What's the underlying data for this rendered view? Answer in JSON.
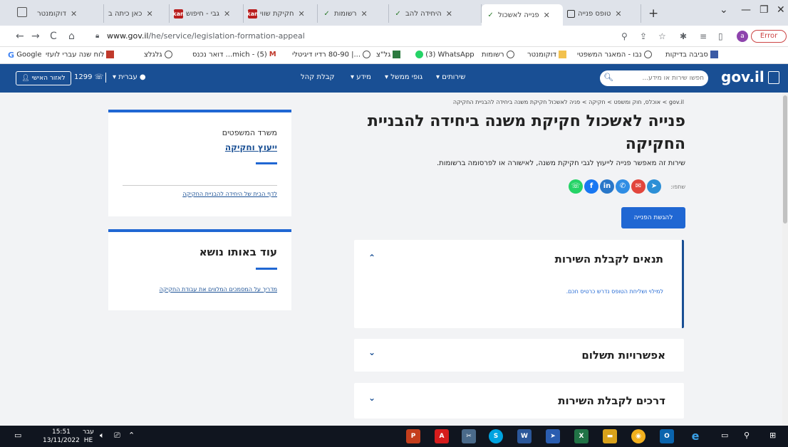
{
  "browser": {
    "tabs": [
      {
        "title": "דוקומנטר",
        "icon": "doc-icon"
      },
      {
        "title": "כאן כיתה ב",
        "icon": "bar-icon"
      },
      {
        "title": "גבי - חיפוש",
        "icon": "kan-icon"
      },
      {
        "title": "חקיקת שווי",
        "icon": "kan-icon"
      },
      {
        "title": "רשומות",
        "icon": "check-icon"
      },
      {
        "title": "היחידה להב",
        "icon": "check-icon"
      },
      {
        "title": "פנייה לאשכול",
        "icon": "check-icon",
        "active": true
      },
      {
        "title": "טופס פנייה",
        "icon": "doc-icon"
      }
    ],
    "url_host": "www.gov.il",
    "url_path": "/he/service/legislation-formation-appeal",
    "error_label": "Error",
    "avatar_letter": "a",
    "bookmarks": [
      "Google",
      "לוח שנה עברי לועזי",
      "גלגלצ",
      "(5) - mich... דואר נכנס",
      "...| 80-90 רדיו דיגיטלי",
      "גל\"צ",
      "(3) WhatsApp",
      "רשומות",
      "דוקומנטר",
      "נבו - המאגר המשפטי",
      "סביבה בדיקות"
    ]
  },
  "site": {
    "logo": "gov.il",
    "search_placeholder": "חפשו שירות או מידע...",
    "nav": [
      "שירותים",
      "גופי ממשל",
      "מידע",
      "קבלת קהל"
    ],
    "language": "עברית",
    "phone": "1299",
    "personal_area": "לאזור האישי"
  },
  "page": {
    "breadcrumb": "gov.il > אוכלס, חוק ומשפט > חקיקה > פניה לאשכול חקיקת משנה ביחידה להבניית החקיקה",
    "title": "פנייה לאשכול חקיקת משנה ביחידה להבניית החקיקה",
    "subtitle": "שירות זה מאפשר פנייה לייעוץ לגבי חקיקת משנה, לאישורה או לפרסומה ברשומות.",
    "share_label": "שתפו:",
    "apply_button": "להגשת הפנייה",
    "accordions": [
      {
        "title": "תנאים לקבלת השירות",
        "body": "למילוי ושליחת הטופס נדרש כרטיס חכם.",
        "open": true
      },
      {
        "title": "אפשרויות תשלום",
        "open": false
      },
      {
        "title": "דרכים לקבלת השירות",
        "open": false
      }
    ]
  },
  "sidebar": {
    "ministry": "משרד המשפטים",
    "unit_link": "ייעוץ וחקיקה",
    "unit_page_link": "לדף הבית של היחידה להבניית החקיקה",
    "related_heading": "עוד באותו נושא",
    "related_link": "מדריך על המסמכים המלווים את עבודת החקיקה"
  },
  "taskbar": {
    "time": "15:51",
    "date": "13/11/2022",
    "lang_top": "עבר",
    "lang_bottom": "HE"
  },
  "colors": {
    "header_blue": "#194f94",
    "accent_blue": "#2067d3"
  }
}
